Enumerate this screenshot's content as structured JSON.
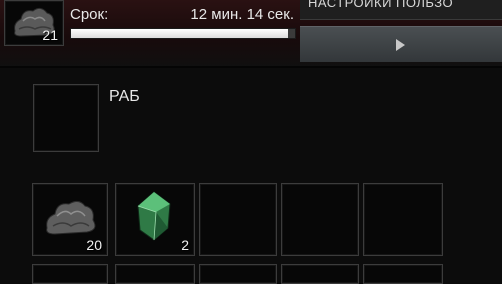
{
  "top_item": {
    "icon": "ore-rock-icon",
    "count": "21"
  },
  "timer": {
    "label": "Срок:",
    "value": "12 мин. 14 сек.",
    "progress": 0.97
  },
  "header_tab": {
    "label": "НАСТРОЙКИ ПОЛЬЗО"
  },
  "play_button": {
    "icon": "play-icon"
  },
  "section": {
    "title": "РАБ"
  },
  "inventory": {
    "slots": [
      {
        "icon": "ore-rock-icon",
        "count": "20"
      },
      {
        "icon": "green-crystal-icon",
        "count": "2"
      },
      {
        "icon": "",
        "count": ""
      },
      {
        "icon": "",
        "count": ""
      },
      {
        "icon": "",
        "count": ""
      }
    ]
  },
  "colors": {
    "banner": "#2a1112",
    "progress_fill": "#ffffff",
    "button": "#4a4f52"
  }
}
